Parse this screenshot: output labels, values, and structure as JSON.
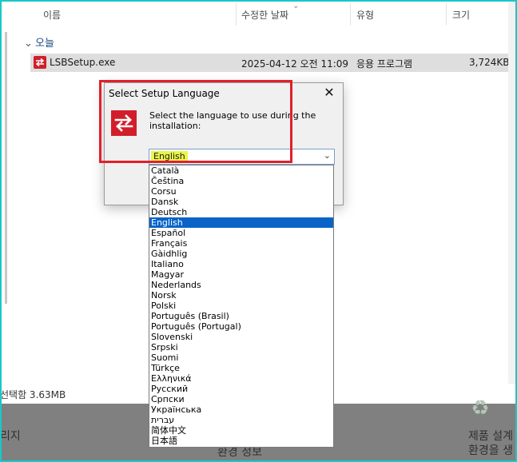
{
  "explorer": {
    "columns": {
      "name": "이름",
      "modified": "수정한 날짜",
      "type": "유형",
      "size": "크기"
    },
    "group_label": "오늘",
    "file": {
      "name": "LSBSetup.exe",
      "modified": "2025-04-12 오전 11:09",
      "type": "응용 프로그램",
      "size": "3,724KB"
    },
    "status": "선택함 3.63MB"
  },
  "background": {
    "left_text": "리지",
    "center_text": "환경 정보",
    "right_line1": "제품 설계",
    "right_line2": "환경을 생"
  },
  "dialog": {
    "title": "Select Setup Language",
    "message": "Select the language to use during the installation:",
    "selected": "English"
  },
  "languages": [
    "Català",
    "Čeština",
    "Corsu",
    "Dansk",
    "Deutsch",
    "English",
    "Español",
    "Français",
    "Gàidhlig",
    "Italiano",
    "Magyar",
    "Nederlands",
    "Norsk",
    "Polski",
    "Português (Brasil)",
    "Português (Portugal)",
    "Slovenski",
    "Srpski",
    "Suomi",
    "Türkçe",
    "Ελληνικά",
    "Русский",
    "Српски",
    "Українська",
    "עברית",
    "简体中文",
    "日本語"
  ],
  "selected_index": 5,
  "colors": {
    "highlight": "#0a64c8",
    "annotation": "#e0202a",
    "selected_text_marker": "#e8f54a"
  }
}
